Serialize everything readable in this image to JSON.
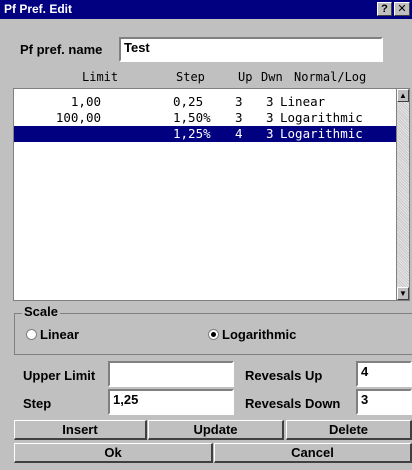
{
  "window": {
    "title": "Pf Pref. Edit",
    "help_label": "?",
    "close_label": "✕"
  },
  "name_field": {
    "label": "Pf pref. name",
    "value": "Test"
  },
  "table": {
    "headers": {
      "limit": "Limit",
      "step": "Step",
      "up": "Up",
      "dwn": "Dwn",
      "normal_log": "Normal/Log"
    },
    "rows": [
      {
        "limit": "1,00",
        "step": "0,25",
        "up": "3",
        "dwn": "3",
        "normal_log": "Linear"
      },
      {
        "limit": "100,00",
        "step": "1,50%",
        "up": "3",
        "dwn": "3",
        "normal_log": "Logarithmic"
      },
      {
        "limit": "",
        "step": "1,25%",
        "up": "4",
        "dwn": "3",
        "normal_log": "Logarithmic"
      }
    ],
    "selected_row": 2,
    "scroll_up_icon": "arrow-up",
    "scroll_down_icon": "arrow-down"
  },
  "scale": {
    "label": "Scale",
    "linear_label": "Linear",
    "log_label": "Logarithmic",
    "selected": "log"
  },
  "form": {
    "upper_limit_label": "Upper Limit",
    "upper_limit_value": "",
    "step_label": "Step",
    "step_value": "1,25",
    "reversals_up_label": "Revesals Up",
    "reversals_up_value": "4",
    "reversals_down_label": "Revesals Down",
    "reversals_down_value": "3"
  },
  "buttons": {
    "insert": "Insert",
    "update": "Update",
    "delete": "Delete",
    "ok": "Ok",
    "cancel": "Cancel"
  },
  "colors": {
    "titlebar": "#000080",
    "selection": "#000080",
    "face": "#c0c0c0"
  }
}
